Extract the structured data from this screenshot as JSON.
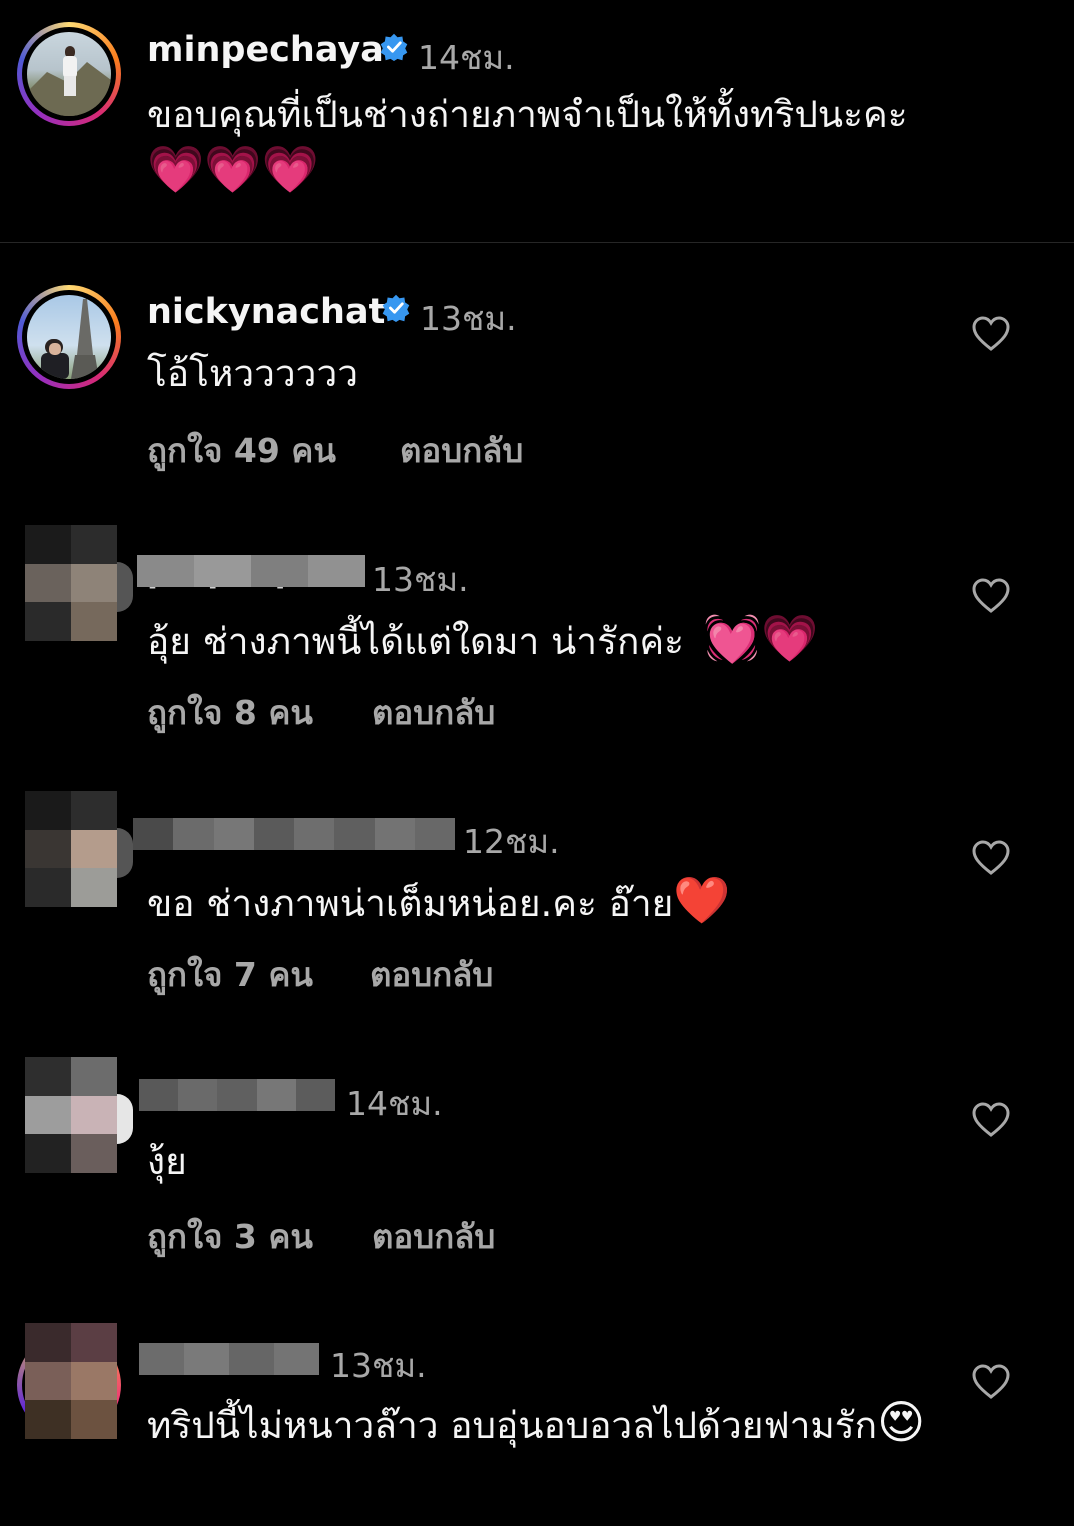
{
  "caption": {
    "username": "minpechaya",
    "time": "14ชม.",
    "text": "ขอบคุณที่เป็นช่างถ่ายภาพจำเป็นให้ทั้งทริปนะคะ",
    "emojis": "💗💗💗"
  },
  "comments": [
    {
      "username": "nickynachat",
      "verified": true,
      "time": "13ชม.",
      "text": "โอ้โหวววววว",
      "likes": "ถูกใจ 49 คน",
      "reply": "ตอบกลับ"
    },
    {
      "username": "praphapont",
      "verified": false,
      "time": "13ชม.",
      "text": "อุ้ย ช่างภาพนี้ได้แต่ใดมา น่ารักค่ะ",
      "emojis": "💓💗",
      "likes": "ถูกใจ 8 คน",
      "reply": "ตอบกลับ"
    },
    {
      "username": "",
      "verified": false,
      "time": "12ชม.",
      "text": "ขอ ช่างภาพน่าเต็มหน่อย.คะ อ๊าย",
      "emojis": "❤️",
      "likes": "ถูกใจ 7 คน",
      "reply": "ตอบกลับ"
    },
    {
      "username": "",
      "verified": false,
      "time": "14ชม.",
      "text": "งุ้ย",
      "likes": "ถูกใจ 3 คน",
      "reply": "ตอบกลับ"
    },
    {
      "username": "",
      "verified": false,
      "time": "13ชม.",
      "text": "ทริปนี้ไม่หนาวล๊าว อบอุ่นอบอวลไปด้วยฟามรัก",
      "emojis": "😍"
    }
  ],
  "colors": {
    "background": "#000000",
    "text": "#f5f5f5",
    "secondary": "#a8a8a8",
    "verified": "#3797f0",
    "divider": "#262626"
  },
  "icons": [
    "verified-badge-icon",
    "heart-outline-icon"
  ]
}
